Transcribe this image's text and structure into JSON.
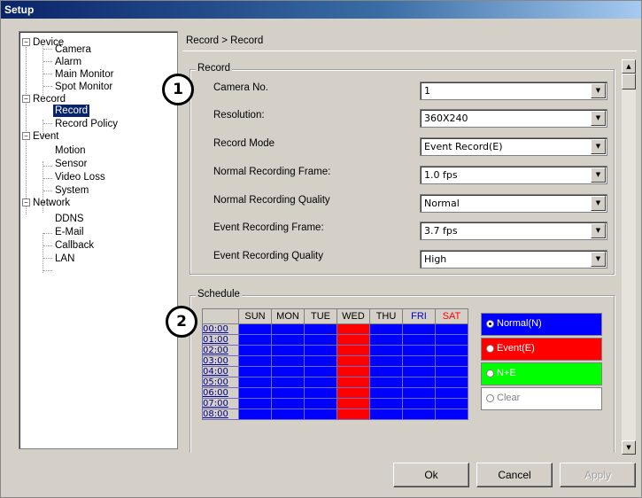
{
  "window": {
    "title": "Setup"
  },
  "tree": {
    "device": "Device",
    "camera": "Camera",
    "alarm": "Alarm",
    "main_monitor": "Main Monitor",
    "spot_monitor": "Spot Monitor",
    "record": "Record",
    "record_sel": "Record",
    "record_policy": "Record Policy",
    "event": "Event",
    "motion": "Motion",
    "sensor": "Sensor",
    "video_loss": "Video Loss",
    "system": "System",
    "network": "Network",
    "ddns": "DDNS",
    "email": "E-Mail",
    "callback": "Callback",
    "lan": "LAN"
  },
  "breadcrumb": "Record > Record",
  "record_group": {
    "title": "Record",
    "fields": [
      {
        "label": "Camera No.",
        "value": "1"
      },
      {
        "label": "Resolution:",
        "value": "360X240"
      },
      {
        "label": "Record Mode",
        "value": "Event Record(E)"
      },
      {
        "label": "Normal Recording Frame:",
        "value": "1.0 fps"
      },
      {
        "label": "Normal Recording Quality",
        "value": "Normal"
      },
      {
        "label": "Event Recording Frame:",
        "value": "3.7 fps"
      },
      {
        "label": "Event Recording Quality",
        "value": "High"
      }
    ]
  },
  "schedule": {
    "title": "Schedule",
    "days": [
      "SUN",
      "MON",
      "TUE",
      "WED",
      "THU",
      "FRI",
      "SAT"
    ],
    "day_colors": [
      "#000000",
      "#000000",
      "#000000",
      "#000000",
      "#000000",
      "#0000cc",
      "#ff0000"
    ],
    "times": [
      "00:00",
      "01:00",
      "02:00",
      "03:00",
      "04:00",
      "05:00",
      "06:00",
      "07:00",
      "08:00"
    ],
    "legend": [
      {
        "label": "Normal(N)",
        "bg": "#0000ff",
        "fg": "#ffffff"
      },
      {
        "label": "Event(E)",
        "bg": "#ff0000",
        "fg": "#ffffff"
      },
      {
        "label": "N+E",
        "bg": "#00ff00",
        "fg": "#ffffff"
      },
      {
        "label": "Clear",
        "bg": "#ffffff",
        "fg": "#808080"
      }
    ]
  },
  "callouts": {
    "one": "1",
    "two": "2"
  },
  "buttons": {
    "ok": "Ok",
    "cancel": "Cancel",
    "apply": "Apply"
  }
}
